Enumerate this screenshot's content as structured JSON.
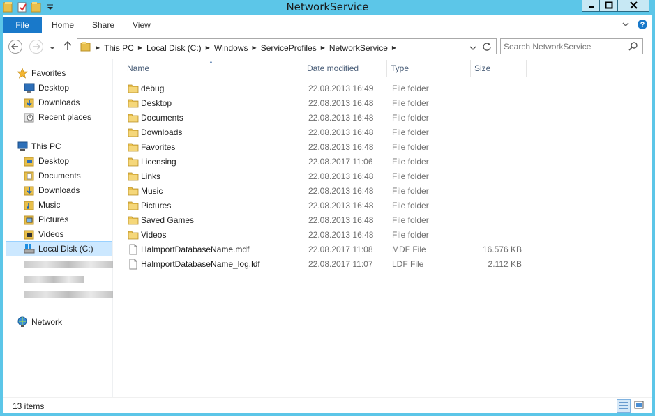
{
  "window": {
    "title": "NetworkService"
  },
  "ribbon": {
    "tabs": [
      "File",
      "Home",
      "Share",
      "View"
    ]
  },
  "address": {
    "crumbs": [
      "This PC",
      "Local Disk (C:)",
      "Windows",
      "ServiceProfiles",
      "NetworkService"
    ]
  },
  "search": {
    "placeholder": "Search NetworkService"
  },
  "nav": {
    "favorites": {
      "label": "Favorites",
      "items": [
        "Desktop",
        "Downloads",
        "Recent places"
      ]
    },
    "this_pc": {
      "label": "This PC",
      "items": [
        "Desktop",
        "Documents",
        "Downloads",
        "Music",
        "Pictures",
        "Videos",
        "Local Disk (C:)"
      ]
    },
    "network": {
      "label": "Network"
    }
  },
  "columns": [
    "Name",
    "Date modified",
    "Type",
    "Size"
  ],
  "files": [
    {
      "name": "debug",
      "date": "22.08.2013 16:49",
      "type": "File folder",
      "size": "",
      "icon": "folder-icon"
    },
    {
      "name": "Desktop",
      "date": "22.08.2013 16:48",
      "type": "File folder",
      "size": "",
      "icon": "folder-icon"
    },
    {
      "name": "Documents",
      "date": "22.08.2013 16:48",
      "type": "File folder",
      "size": "",
      "icon": "folder-icon"
    },
    {
      "name": "Downloads",
      "date": "22.08.2013 16:48",
      "type": "File folder",
      "size": "",
      "icon": "folder-icon"
    },
    {
      "name": "Favorites",
      "date": "22.08.2013 16:48",
      "type": "File folder",
      "size": "",
      "icon": "folder-icon"
    },
    {
      "name": "Licensing",
      "date": "22.08.2017 11:06",
      "type": "File folder",
      "size": "",
      "icon": "folder-icon"
    },
    {
      "name": "Links",
      "date": "22.08.2013 16:48",
      "type": "File folder",
      "size": "",
      "icon": "folder-icon"
    },
    {
      "name": "Music",
      "date": "22.08.2013 16:48",
      "type": "File folder",
      "size": "",
      "icon": "folder-icon"
    },
    {
      "name": "Pictures",
      "date": "22.08.2013 16:48",
      "type": "File folder",
      "size": "",
      "icon": "folder-icon"
    },
    {
      "name": "Saved Games",
      "date": "22.08.2013 16:48",
      "type": "File folder",
      "size": "",
      "icon": "folder-icon"
    },
    {
      "name": "Videos",
      "date": "22.08.2013 16:48",
      "type": "File folder",
      "size": "",
      "icon": "folder-icon"
    },
    {
      "name": "HalmportDatabaseName.mdf",
      "date": "22.08.2017 11:08",
      "type": "MDF File",
      "size": "16.576 KB",
      "icon": "file-icon"
    },
    {
      "name": "HalmportDatabaseName_log.ldf",
      "date": "22.08.2017 11:07",
      "type": "LDF File",
      "size": "2.112 KB",
      "icon": "file-icon"
    }
  ],
  "status": {
    "items_count": "13 items"
  },
  "colors": {
    "titlebar": "#5cc6e8",
    "file_tab": "#1979ca",
    "selection": "#cce8ff",
    "folder": "#e8bf4b"
  }
}
